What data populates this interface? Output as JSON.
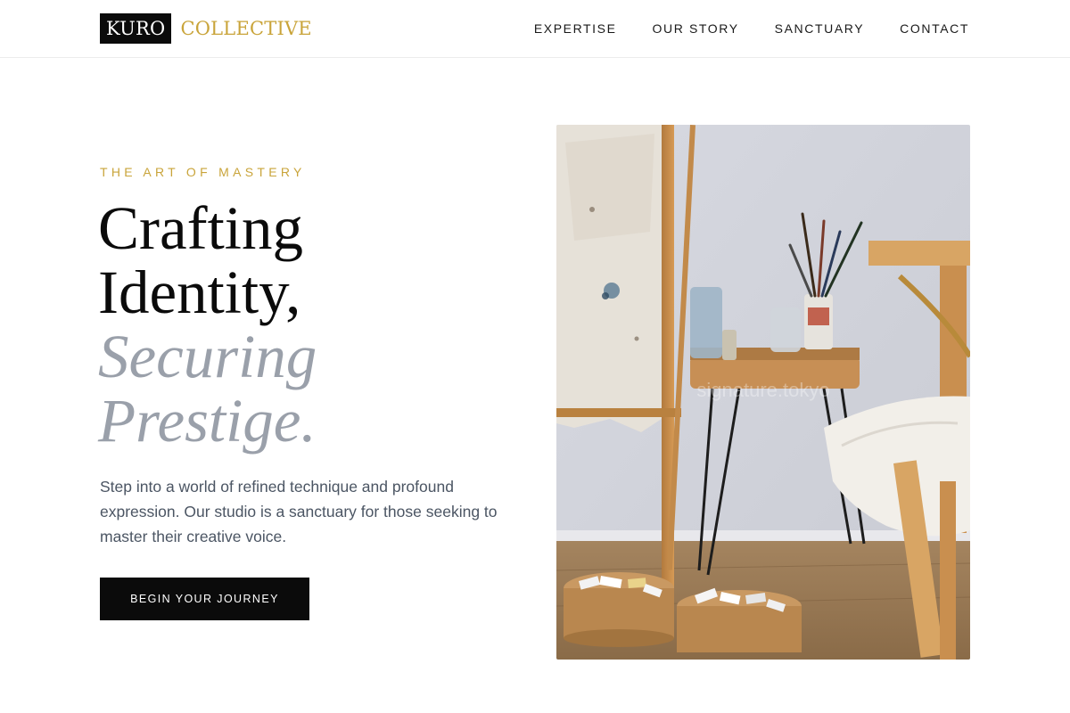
{
  "header": {
    "logo": {
      "mark": "KURO",
      "word": "COLLECTIVE"
    },
    "nav": [
      {
        "label": "EXPERTISE"
      },
      {
        "label": "OUR STORY"
      },
      {
        "label": "SANCTUARY"
      },
      {
        "label": "CONTACT"
      }
    ]
  },
  "hero": {
    "eyebrow": "THE ART OF MASTERY",
    "headline": {
      "line1": "Crafting",
      "line2": "Identity,",
      "line3": "Securing",
      "line4": "Prestige."
    },
    "body": "Step into a world of refined technique and profound expression. Our studio is a sanctuary for those seeking to master their creative voice.",
    "cta_label": "BEGIN YOUR JOURNEY",
    "image": {
      "subject": "artist studio with easel, brushes and paint tubes",
      "watermark": "signature.tokyo"
    }
  },
  "colors": {
    "accent_gold": "#c9a43a",
    "ink": "#0b0b0b",
    "muted_gray": "#9aa0aa",
    "body_text": "#4b5563"
  }
}
